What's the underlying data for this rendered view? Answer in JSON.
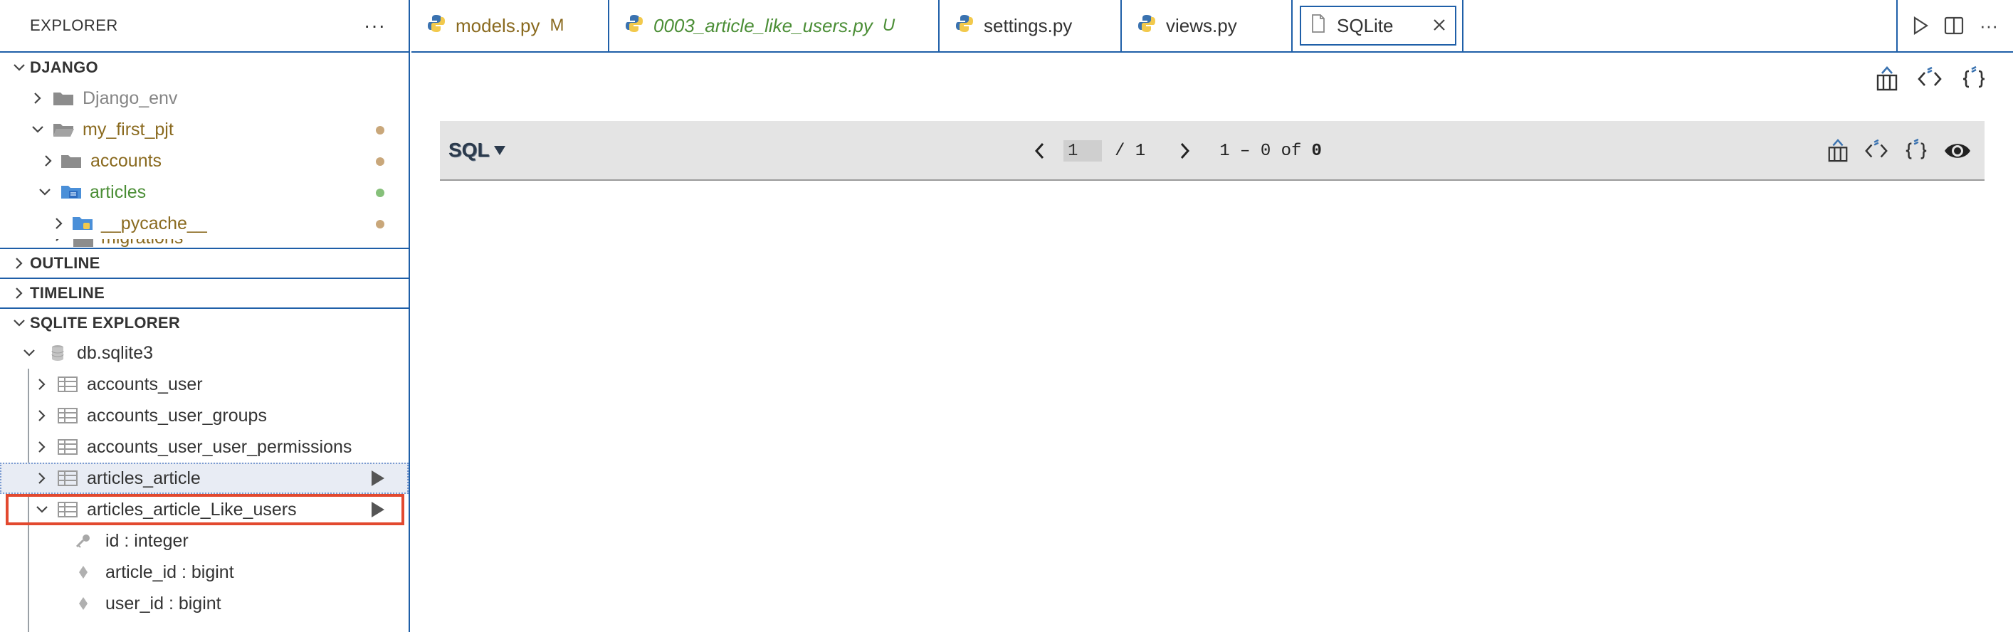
{
  "explorer": {
    "title": "EXPLORER",
    "more": "···"
  },
  "workspace": {
    "name": "DJANGO",
    "items": [
      {
        "label": "Django_env",
        "color": "#858585"
      },
      {
        "label": "my_first_pjt",
        "color": "#8a6a1f"
      },
      {
        "label": "accounts",
        "color": "#8a6a1f"
      },
      {
        "label": "articles",
        "color": "#4b8e36"
      },
      {
        "label": "__pycache__",
        "color": "#8a6a1f"
      },
      {
        "label": "migrations",
        "color": "#8a6a1f"
      }
    ]
  },
  "sections": {
    "outline": "OUTLINE",
    "timeline": "TIMELINE",
    "sqlite": "SQLITE EXPLORER"
  },
  "db": {
    "name": "db.sqlite3",
    "tables": [
      "accounts_user",
      "accounts_user_groups",
      "accounts_user_user_permissions",
      "articles_article",
      "articles_article_Like_users"
    ],
    "columns": [
      "id : integer",
      "article_id : bigint",
      "user_id : bigint"
    ]
  },
  "tabs": [
    {
      "label": "models.py",
      "mark": "M",
      "color": "#8a6a1f"
    },
    {
      "label": "0003_article_like_users.py",
      "mark": "U",
      "color": "#4b8e36"
    },
    {
      "label": "settings.py",
      "mark": "",
      "color": "#333333"
    },
    {
      "label": "views.py",
      "mark": "",
      "color": "#333333"
    },
    {
      "label": "SQLite",
      "mark": "",
      "color": "#333333"
    }
  ],
  "toolbar": {
    "sql_label": "SQL",
    "page_value": "1",
    "page_total": "/ 1",
    "range": "1 – 0 of",
    "count": "0"
  },
  "colors": {
    "accent": "#1f5fa8",
    "highlight": "#e2492f",
    "modified_dot": "#c9a77a",
    "untracked_dot": "#86c07a"
  }
}
